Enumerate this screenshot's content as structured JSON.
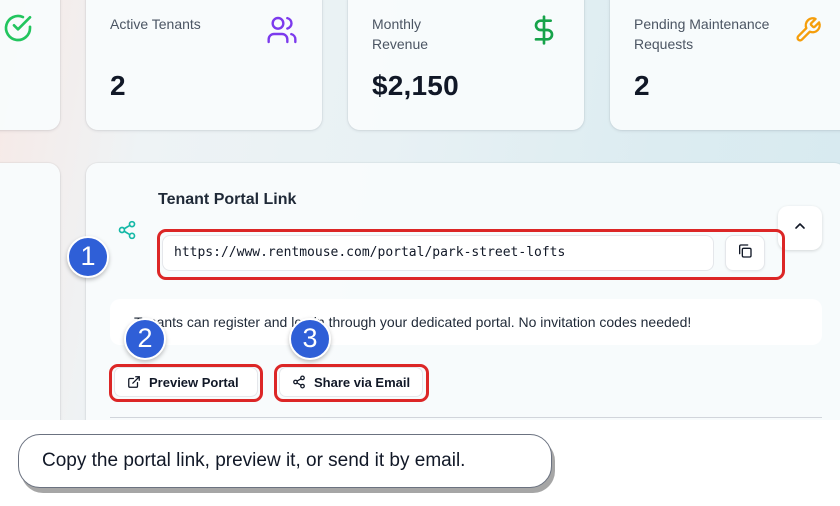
{
  "stats": [
    {
      "label": "Active Tenants",
      "value": "2",
      "icon": "users-icon",
      "icon_color": "#7c3aed"
    },
    {
      "label": "Monthly Revenue",
      "value": "$2,150",
      "icon": "dollar-icon",
      "icon_color": "#16a34a"
    },
    {
      "label": "Pending Maintenance Requests",
      "value": "2",
      "icon": "wrench-icon",
      "icon_color": "#f59e0b"
    }
  ],
  "portal": {
    "title": "Tenant Portal Link",
    "url": "https://www.rentmouse.com/portal/park-street-lofts",
    "info_text": "Tenants can register and log in through your dedicated portal. No invitation codes needed!",
    "preview_label": "Preview Portal",
    "share_label": "Share via Email"
  },
  "annotations": {
    "badge1": "1",
    "badge2": "2",
    "badge3": "3",
    "highlight_color": "#dc2626",
    "badge_color": "#2f5fd7"
  },
  "tooltip": {
    "text": "Copy the portal link, preview it, or send it by email."
  },
  "colors": {
    "accent_teal": "#14b8a6",
    "check_green": "#22c55e"
  }
}
